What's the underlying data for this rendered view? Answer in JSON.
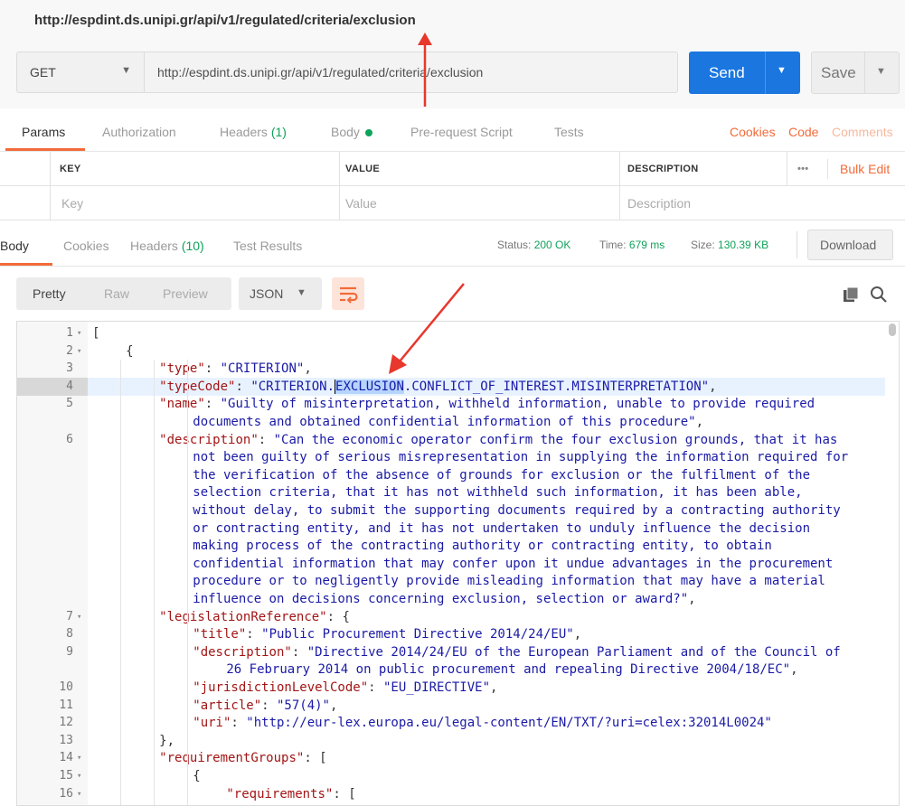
{
  "window_url": "http://espdint.ds.unipi.gr/api/v1/regulated/criteria/exclusion",
  "request": {
    "method": "GET",
    "url": "http://espdint.ds.unipi.gr/api/v1/regulated/criteria/exclusion",
    "send_label": "Send",
    "save_label": "Save"
  },
  "request_tabs": {
    "params": "Params",
    "authorization": "Authorization",
    "headers": "Headers",
    "headers_count": "(1)",
    "body": "Body",
    "prerequest": "Pre-request Script",
    "tests": "Tests",
    "cookies": "Cookies",
    "code": "Code",
    "comments": "Comments"
  },
  "params_table": {
    "headers": {
      "key": "KEY",
      "value": "VALUE",
      "description": "DESCRIPTION",
      "more": "•••",
      "bulk_edit": "Bulk Edit"
    },
    "placeholders": {
      "key": "Key",
      "value": "Value",
      "description": "Description"
    }
  },
  "response_tabs": {
    "body": "Body",
    "cookies": "Cookies",
    "headers": "Headers",
    "headers_count": "(10)",
    "test_results": "Test Results"
  },
  "response_status": {
    "status_label": "Status:",
    "status_value": "200 OK",
    "time_label": "Time:",
    "time_value": "679 ms",
    "size_label": "Size:",
    "size_value": "130.39 KB",
    "download_label": "Download"
  },
  "view": {
    "pretty": "Pretty",
    "raw": "Raw",
    "preview": "Preview",
    "format": "JSON"
  },
  "code_lines": [
    {
      "num": "1",
      "fold": true,
      "indent": 0,
      "segs": [
        [
          "p",
          "["
        ]
      ]
    },
    {
      "num": "2",
      "fold": true,
      "indent": 1,
      "segs": [
        [
          "p",
          "{"
        ]
      ]
    },
    {
      "num": "3",
      "indent": 2,
      "segs": [
        [
          "k",
          "\"type\""
        ],
        [
          "p",
          ": "
        ],
        [
          "s",
          "\"CRITERION\""
        ],
        [
          "p",
          ","
        ]
      ]
    },
    {
      "num": "4",
      "hl": true,
      "indent": 2,
      "segs": [
        [
          "k",
          "\"typeCode\""
        ],
        [
          "p",
          ": "
        ],
        [
          "s",
          "\"CRITERION."
        ],
        [
          "caret",
          ""
        ],
        [
          "sel",
          "EXCLUSION"
        ],
        [
          "s",
          ".CONFLICT_OF_INTEREST.MISINTERPRETATION\""
        ],
        [
          "p",
          ","
        ]
      ]
    },
    {
      "num": "5",
      "indent": 2,
      "segs": [
        [
          "k",
          "\"name\""
        ],
        [
          "p",
          ": "
        ],
        [
          "s",
          "\"Guilty of misinterpretation, withheld information, unable to provide required"
        ]
      ]
    },
    {
      "num": "",
      "indent": 3,
      "segs": [
        [
          "s",
          "documents and obtained confidential information of this procedure\""
        ],
        [
          "p",
          ","
        ]
      ]
    },
    {
      "num": "6",
      "indent": 2,
      "segs": [
        [
          "k",
          "\"description\""
        ],
        [
          "p",
          ": "
        ],
        [
          "s",
          "\"Can the economic operator confirm the four exclusion grounds, that it has"
        ]
      ]
    },
    {
      "num": "",
      "indent": 3,
      "segs": [
        [
          "s",
          "not been guilty of serious misrepresentation in supplying the information required for"
        ]
      ]
    },
    {
      "num": "",
      "indent": 3,
      "segs": [
        [
          "s",
          "the verification of the absence of grounds for exclusion or the fulfilment of the"
        ]
      ]
    },
    {
      "num": "",
      "indent": 3,
      "segs": [
        [
          "s",
          "selection criteria, that it has not withheld such information, it has been able,"
        ]
      ]
    },
    {
      "num": "",
      "indent": 3,
      "segs": [
        [
          "s",
          "without delay, to submit the supporting documents required by a contracting authority"
        ]
      ]
    },
    {
      "num": "",
      "indent": 3,
      "segs": [
        [
          "s",
          "or contracting entity, and it has not undertaken to unduly influence the decision"
        ]
      ]
    },
    {
      "num": "",
      "indent": 3,
      "segs": [
        [
          "s",
          "making process of the contracting authority or contracting entity, to obtain"
        ]
      ]
    },
    {
      "num": "",
      "indent": 3,
      "segs": [
        [
          "s",
          "confidential information that may confer upon it undue advantages in the procurement"
        ]
      ]
    },
    {
      "num": "",
      "indent": 3,
      "segs": [
        [
          "s",
          "procedure or to negligently provide misleading information that may have a material"
        ]
      ]
    },
    {
      "num": "",
      "indent": 3,
      "segs": [
        [
          "s",
          "influence on decisions concerning exclusion, selection or award?\""
        ],
        [
          "p",
          ","
        ]
      ]
    },
    {
      "num": "7",
      "fold": true,
      "indent": 2,
      "segs": [
        [
          "k",
          "\"legislationReference\""
        ],
        [
          "p",
          ": {"
        ]
      ]
    },
    {
      "num": "8",
      "indent": 3,
      "segs": [
        [
          "k",
          "\"title\""
        ],
        [
          "p",
          ": "
        ],
        [
          "s",
          "\"Public Procurement Directive 2014/24/EU\""
        ],
        [
          "p",
          ","
        ]
      ]
    },
    {
      "num": "9",
      "indent": 3,
      "segs": [
        [
          "k",
          "\"description\""
        ],
        [
          "p",
          ": "
        ],
        [
          "s",
          "\"Directive 2014/24/EU of the European Parliament and of the Council of"
        ]
      ]
    },
    {
      "num": "",
      "indent": 4,
      "segs": [
        [
          "s",
          "26 February 2014 on public procurement and repealing Directive 2004/18/EC\""
        ],
        [
          "p",
          ","
        ]
      ]
    },
    {
      "num": "10",
      "indent": 3,
      "segs": [
        [
          "k",
          "\"jurisdictionLevelCode\""
        ],
        [
          "p",
          ": "
        ],
        [
          "s",
          "\"EU_DIRECTIVE\""
        ],
        [
          "p",
          ","
        ]
      ]
    },
    {
      "num": "11",
      "indent": 3,
      "segs": [
        [
          "k",
          "\"article\""
        ],
        [
          "p",
          ": "
        ],
        [
          "s",
          "\"57(4)\""
        ],
        [
          "p",
          ","
        ]
      ]
    },
    {
      "num": "12",
      "indent": 3,
      "segs": [
        [
          "k",
          "\"uri\""
        ],
        [
          "p",
          ": "
        ],
        [
          "s",
          "\"http://eur-lex.europa.eu/legal-content/EN/TXT/?uri=celex:32014L0024\""
        ]
      ]
    },
    {
      "num": "13",
      "indent": 2,
      "segs": [
        [
          "p",
          "},"
        ]
      ]
    },
    {
      "num": "14",
      "fold": true,
      "indent": 2,
      "segs": [
        [
          "k",
          "\"requirementGroups\""
        ],
        [
          "p",
          ": ["
        ]
      ]
    },
    {
      "num": "15",
      "fold": true,
      "indent": 3,
      "segs": [
        [
          "p",
          "{"
        ]
      ]
    },
    {
      "num": "16",
      "fold": true,
      "indent": 4,
      "segs": [
        [
          "k",
          "\"requirements\""
        ],
        [
          "p",
          ": ["
        ]
      ]
    }
  ],
  "colors": {
    "send_blue": "#1b76e0",
    "accent_orange": "#f26b3a",
    "status_green": "#0fa35a",
    "json_key": "#a31515",
    "json_string": "#1a1aa6",
    "annotation_arrow": "#e8372c"
  },
  "icons": [
    "caret-down-icon",
    "wrap-lines-icon",
    "copy-icon",
    "search-icon",
    "fold-arrow-icon",
    "annotation-arrow-icon"
  ]
}
